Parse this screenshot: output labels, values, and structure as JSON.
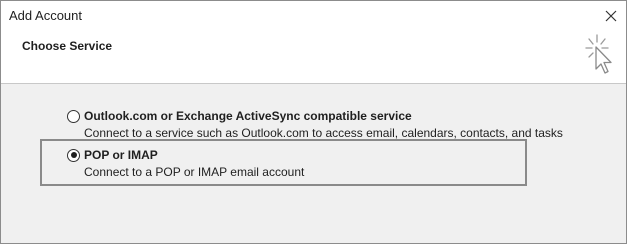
{
  "window": {
    "title": "Add Account",
    "close_icon": "close-icon"
  },
  "header": {
    "section_title": "Choose Service",
    "icon": "wizard-cursor-icon"
  },
  "options": [
    {
      "label": "Outlook.com or Exchange ActiveSync compatible service",
      "description": "Connect to a service such as Outlook.com to access email, calendars, contacts, and tasks",
      "selected": false
    },
    {
      "label": "POP or IMAP",
      "description": "Connect to a POP or IMAP email account",
      "selected": true
    }
  ]
}
